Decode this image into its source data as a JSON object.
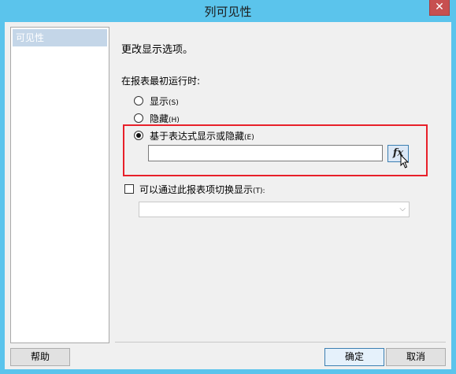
{
  "window": {
    "title": "列可见性",
    "close_glyph": "✕"
  },
  "nav": {
    "items": [
      {
        "label": "可见性",
        "selected": true
      }
    ]
  },
  "content": {
    "heading": "更改显示选项。",
    "section_label": "在报表最初运行时:",
    "options": [
      {
        "label": "显示",
        "key": "(S)",
        "checked": false
      },
      {
        "label": "隐藏",
        "key": "(H)",
        "checked": false
      },
      {
        "label": "基于表达式显示或隐藏",
        "key": "(E)",
        "checked": true
      }
    ],
    "expression": {
      "value": "",
      "fx_label": "fx"
    },
    "toggle": {
      "label": "可以通过此报表项切换显示",
      "key": "(T):",
      "checked": false
    },
    "dropdown": {
      "value": "",
      "chevron": "⌵"
    }
  },
  "footer": {
    "help_label": "帮助",
    "ok_label": "确定",
    "cancel_label": "取消"
  },
  "colors": {
    "titlebar": "#5bc4ec",
    "highlight": "#e8202a",
    "close": "#c75050"
  }
}
